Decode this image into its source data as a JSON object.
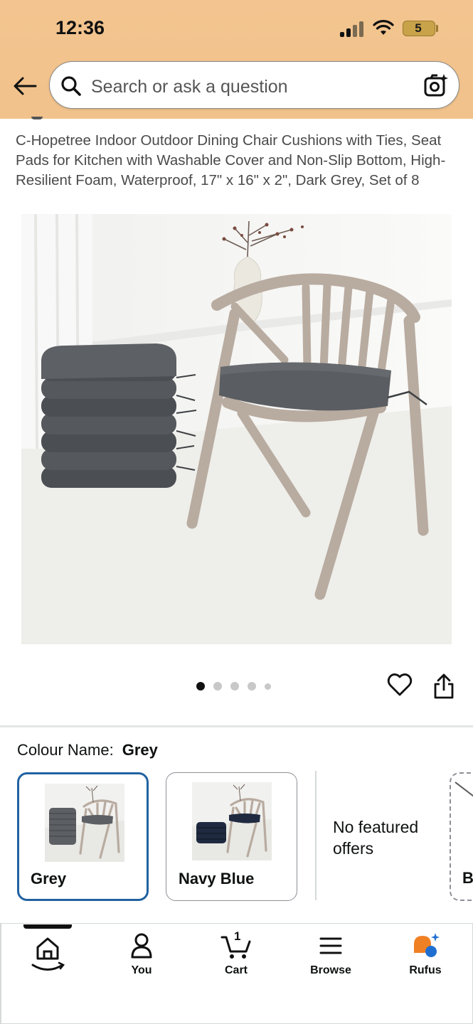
{
  "status_bar": {
    "time": "12:36",
    "battery": "5"
  },
  "search": {
    "placeholder": "Search or ask a question"
  },
  "product": {
    "title": "C-Hopetree Indoor Outdoor Dining Chair Cushions with Ties, Seat Pads for Kitchen with Washable Cover and Non-Slip Bottom, High-Resilient Foam, Waterproof, 17\" x 16\" x 2\", Dark Grey, Set of 8",
    "image_count": 5,
    "active_image": 1
  },
  "variations": {
    "label": "Colour Name:",
    "selected_value": "Grey",
    "options": [
      {
        "label": "Grey",
        "selected": true,
        "cushion_color": "#5c5f63"
      },
      {
        "label": "Navy Blue",
        "selected": false,
        "cushion_color": "#1f2a40"
      }
    ],
    "no_offers_text": "No featured offers",
    "partial_label": "B"
  },
  "bottom_nav": {
    "items": [
      {
        "label": "",
        "icon": "home-icon"
      },
      {
        "label": "You",
        "icon": "person-icon"
      },
      {
        "label": "Cart",
        "icon": "cart-icon",
        "count": "1"
      },
      {
        "label": "Browse",
        "icon": "menu-icon"
      },
      {
        "label": "Rufus",
        "icon": "rufus-icon"
      }
    ]
  },
  "colors": {
    "header_bg": "#f2c38d",
    "selected_border": "#2162a1",
    "rufus_orange": "#f08024",
    "rufus_blue": "#1f6fd0"
  }
}
